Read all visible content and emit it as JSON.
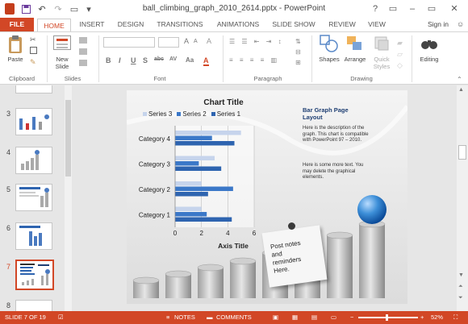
{
  "window": {
    "title": "ball_climbing_graph_2010_2614.pptx - PowerPoint",
    "help": "?",
    "min": "–",
    "max": "▭",
    "close": "✕"
  },
  "tabs": [
    {
      "label": "FILE"
    },
    {
      "label": "HOME"
    },
    {
      "label": "INSERT"
    },
    {
      "label": "DESIGN"
    },
    {
      "label": "TRANSITIONS"
    },
    {
      "label": "ANIMATIONS"
    },
    {
      "label": "SLIDE SHOW"
    },
    {
      "label": "REVIEW"
    },
    {
      "label": "VIEW"
    }
  ],
  "signin": "Sign in",
  "ribbon": {
    "paste": "Paste",
    "new_slide": "New\nSlide",
    "shapes": "Shapes",
    "arrange": "Arrange",
    "quick_styles": "Quick\nStyles",
    "editing": "Editing",
    "groups": {
      "clipboard": "Clipboard",
      "slides": "Slides",
      "font": "Font",
      "paragraph": "Paragraph",
      "drawing": "Drawing"
    },
    "fmt": [
      "B",
      "I",
      "U",
      "S",
      "abc",
      "AV",
      "Aa",
      "A"
    ]
  },
  "thumbs": [
    {
      "num": "3"
    },
    {
      "num": "4"
    },
    {
      "num": "5"
    },
    {
      "num": "6"
    },
    {
      "num": "7"
    },
    {
      "num": "8"
    }
  ],
  "slide": {
    "chart_title": "Chart Title",
    "axis_title": "Axis Title",
    "legend": [
      "Series 3",
      "Series 2",
      "Series 1"
    ],
    "text_heading": "Bar Graph Page\nLayout",
    "text_body1": "Here is the description of the graph. This chart is compatible with PowerPoint 97 – 2010.",
    "text_body2": "Here is some more text. You may delete the graphical elements.",
    "note": "Post notes\nand\nreminders\nHere."
  },
  "chart_data": {
    "type": "bar",
    "orientation": "horizontal",
    "title": "Chart Title",
    "xlabel": "Axis Title",
    "categories": [
      "Category 1",
      "Category 2",
      "Category 3",
      "Category 4"
    ],
    "series": [
      {
        "name": "Series 1",
        "values": [
          4.3,
          2.5,
          3.5,
          4.5
        ],
        "color": "#2e64b0"
      },
      {
        "name": "Series 2",
        "values": [
          2.4,
          4.4,
          1.8,
          2.8
        ],
        "color": "#3b78c8"
      },
      {
        "name": "Series 3",
        "values": [
          2.0,
          2.0,
          3.0,
          5.0
        ],
        "color": "#c6d4ec"
      }
    ],
    "xlim": [
      0,
      6
    ],
    "xticks": [
      "0",
      "2",
      "4",
      "6"
    ],
    "grid": true,
    "legend": "top"
  },
  "status": {
    "slide_info": "SLIDE 7 OF 19",
    "notes": "NOTES",
    "comments": "COMMENTS",
    "zoom": "52%"
  },
  "colors": {
    "accent": "#d24726"
  }
}
